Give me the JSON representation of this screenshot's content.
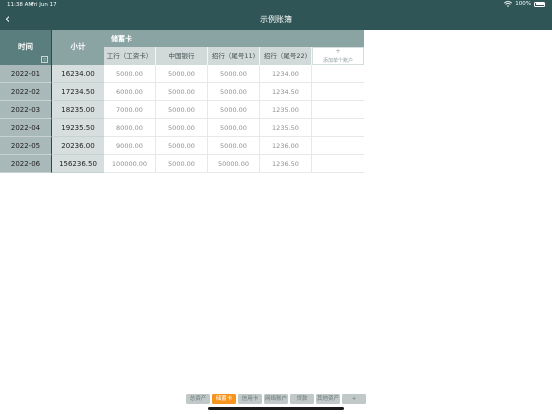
{
  "status": {
    "time": "11:38 AM",
    "date": "Fri Jun 17",
    "battery": "100%"
  },
  "nav": {
    "title": "示例账簿",
    "back": "‹"
  },
  "table": {
    "time_header": "时间",
    "subtotal_header": "小计",
    "sort_glyph": "▽",
    "group_header": "储蓄卡",
    "accounts": [
      "工行（工资卡）",
      "中国银行",
      "招行（尾号11)",
      "招行（尾号22)"
    ],
    "add_account": {
      "plus": "+",
      "label": "添加单个账户"
    },
    "rows": [
      {
        "date": "2022-01",
        "subtotal": "16234.00",
        "values": [
          "5000.00",
          "5000.00",
          "5000.00",
          "1234.00"
        ]
      },
      {
        "date": "2022-02",
        "subtotal": "17234.50",
        "values": [
          "6000.00",
          "5000.00",
          "5000.00",
          "1234.50"
        ]
      },
      {
        "date": "2022-03",
        "subtotal": "18235.00",
        "values": [
          "7000.00",
          "5000.00",
          "5000.00",
          "1235.00"
        ]
      },
      {
        "date": "2022-04",
        "subtotal": "19235.50",
        "values": [
          "8000.00",
          "5000.00",
          "5000.00",
          "1235.50"
        ]
      },
      {
        "date": "2022-05",
        "subtotal": "20236.00",
        "values": [
          "9000.00",
          "5000.00",
          "5000.00",
          "1236.00"
        ]
      },
      {
        "date": "2022-06",
        "subtotal": "156236.50",
        "values": [
          "100000.00",
          "5000.00",
          "50000.00",
          "1236.50"
        ]
      }
    ]
  },
  "tabs": [
    {
      "label": "总资产",
      "active": false
    },
    {
      "label": "储蓄卡",
      "active": true
    },
    {
      "label": "信用卡",
      "active": false
    },
    {
      "label": "网络账户",
      "active": false
    },
    {
      "label": "贷款",
      "active": false
    },
    {
      "label": "其他资产",
      "active": false
    },
    {
      "label": "+",
      "active": false
    }
  ],
  "colors": {
    "nav_bg": "#2f5556",
    "active_tab": "#f7941d"
  }
}
